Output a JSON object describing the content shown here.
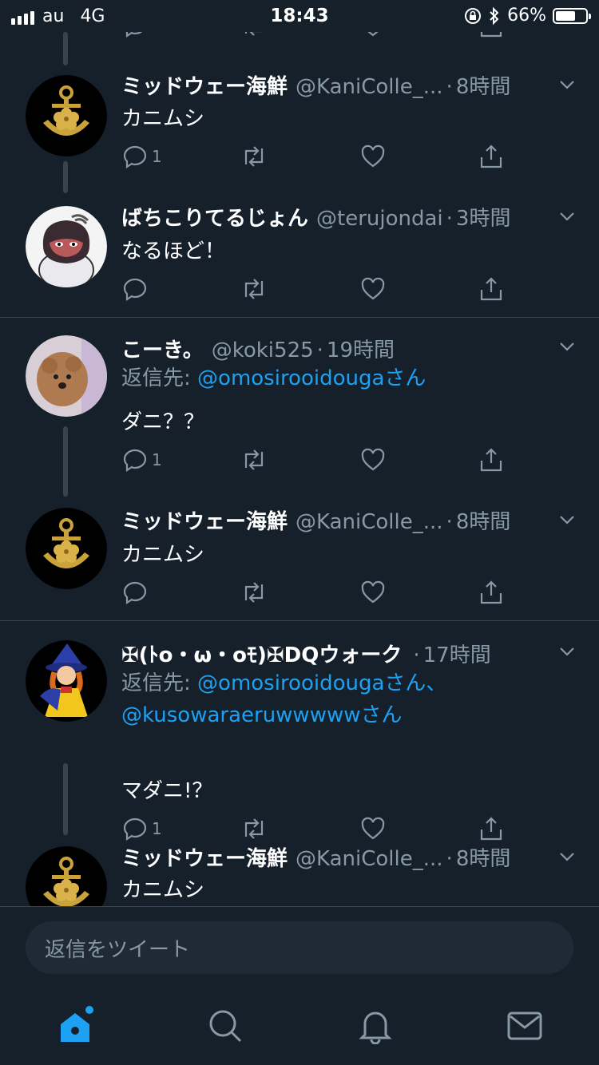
{
  "status": {
    "carrier": "au",
    "network": "4G",
    "time": "18:43",
    "battery": "66%",
    "battery_level": 0.66
  },
  "tweets": [
    {
      "name": "ミッドウェー海鮮",
      "handle": "@KaniColle_...",
      "time": "8時間",
      "text": "カニムシ",
      "replies": "1"
    },
    {
      "name": "ばちこりてるじょん",
      "handle": "@terujondai",
      "time": "3時間",
      "text": "なるほど！"
    },
    {
      "name": "こーき。",
      "handle": "@koki525",
      "time": "19時間",
      "reply_label": "返信先:",
      "mentions": [
        "@omosirooidougaさん"
      ],
      "text": "ダニ？？",
      "replies": "1"
    },
    {
      "name": "ミッドウェー海鮮",
      "handle": "@KaniColle_...",
      "time": "8時間",
      "text": "カニムシ"
    },
    {
      "name": "✠(ﾄo・ω・oﾓ)✠DQウォーク",
      "handle": "",
      "time": "17時間",
      "reply_label": "返信先:",
      "mentions": [
        "@omosirooidougaさん、",
        "@kusowaraeruwwwwwさん"
      ],
      "text": "マダニ!？",
      "replies": "1"
    },
    {
      "name": "ミッドウェー海鮮",
      "handle": "@KaniColle_...",
      "time": "8時間",
      "text": "カニムシ"
    }
  ],
  "separator_dot": "·",
  "composer": {
    "placeholder": "返信をツイート"
  },
  "tabs": [
    "home-icon",
    "search-icon",
    "bell-icon",
    "mail-icon"
  ],
  "colors": {
    "background": "#15202b",
    "accent": "#1da1f2",
    "secondary_text": "#8899a6",
    "divider": "#38444d"
  }
}
